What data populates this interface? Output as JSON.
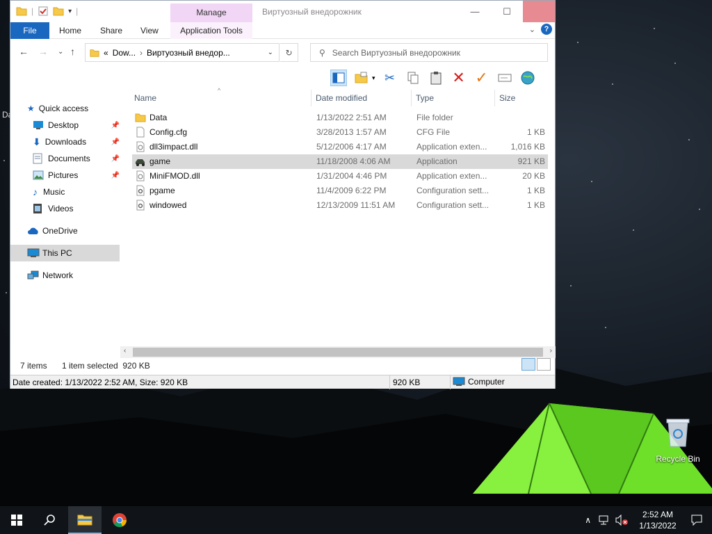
{
  "window": {
    "title": "Виртуозный внедорожник",
    "context_tab_header": "Manage",
    "caption": {
      "minimize": "—",
      "maximize": "☐",
      "close": "✕"
    }
  },
  "ribbon": {
    "tabs": [
      {
        "label": "File"
      },
      {
        "label": "Home"
      },
      {
        "label": "Share"
      },
      {
        "label": "View"
      },
      {
        "label": "Application Tools"
      }
    ]
  },
  "address": {
    "overflow": "«",
    "crumbs": [
      "Dow...",
      "Виртуозный внедор..."
    ],
    "separator": "›"
  },
  "search": {
    "placeholder": "Search Виртуозный внедорожник"
  },
  "nav": {
    "quick_access": "Quick access",
    "items": [
      {
        "label": "Desktop",
        "pinned": true
      },
      {
        "label": "Downloads",
        "pinned": true
      },
      {
        "label": "Documents",
        "pinned": true
      },
      {
        "label": "Pictures",
        "pinned": true
      },
      {
        "label": "Music",
        "pinned": false
      },
      {
        "label": "Videos",
        "pinned": false
      }
    ],
    "onedrive": "OneDrive",
    "this_pc": "This PC",
    "network": "Network"
  },
  "columns": {
    "name": "Name",
    "date": "Date modified",
    "type": "Type",
    "size": "Size"
  },
  "files": [
    {
      "name": "Data",
      "date": "1/13/2022 2:51 AM",
      "type": "File folder",
      "size": "",
      "icon": "folder-icon",
      "selected": false
    },
    {
      "name": "Config.cfg",
      "date": "3/28/2013 1:57 AM",
      "type": "CFG File",
      "size": "1 KB",
      "icon": "file-icon",
      "selected": false
    },
    {
      "name": "dll3impact.dll",
      "date": "5/12/2006 4:17 AM",
      "type": "Application exten...",
      "size": "1,016 KB",
      "icon": "dll-icon",
      "selected": false
    },
    {
      "name": "game",
      "date": "11/18/2008 4:06 AM",
      "type": "Application",
      "size": "921 KB",
      "icon": "game-app-icon",
      "selected": true
    },
    {
      "name": "MiniFMOD.dll",
      "date": "1/31/2004 4:46 PM",
      "type": "Application exten...",
      "size": "20 KB",
      "icon": "dll-icon",
      "selected": false
    },
    {
      "name": "pgame",
      "date": "11/4/2009 6:22 PM",
      "type": "Configuration sett...",
      "size": "1 KB",
      "icon": "settings-file-icon",
      "selected": false
    },
    {
      "name": "windowed",
      "date": "12/13/2009 11:51 AM",
      "type": "Configuration sett...",
      "size": "1 KB",
      "icon": "settings-file-icon",
      "selected": false
    }
  ],
  "status": {
    "count": "7 items",
    "selection": "1 item selected  920 KB"
  },
  "details": {
    "created": "Date created: 1/13/2022 2:52 AM, Size: 920 KB",
    "size": "920 KB",
    "location": "Computer"
  },
  "desktop": {
    "edge_label": "Da",
    "recycle_bin": "Recycle Bin"
  },
  "clock": {
    "time": "2:52 AM",
    "date": "1/13/2022"
  },
  "colors": {
    "accent": "#1a67c0",
    "manage_tab": "#f1d6f5",
    "selection": "#d9d9d9",
    "close_hover": "#e88a91"
  }
}
